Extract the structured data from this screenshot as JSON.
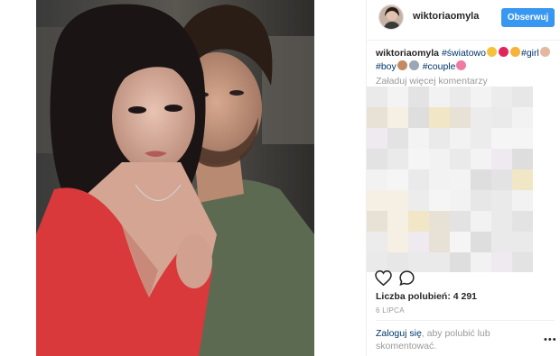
{
  "header": {
    "username": "wiktoriaomyla",
    "follow_label": "Obserwuj"
  },
  "caption": {
    "username": "wiktoriaomyla",
    "tag1": "#światowo",
    "tag2": "#girl",
    "tag3": "#boy",
    "tag4": "#couple"
  },
  "comments": {
    "load_more": "Załaduj więcej komentarzy"
  },
  "actions": {
    "like_icon": "heart-icon",
    "comment_icon": "comment-icon",
    "likes_text": "Liczba polubień: 4 291",
    "date": "6 LIPCA"
  },
  "login": {
    "link": "Zaloguj się",
    "text": ", aby polubić lub skomentować.",
    "more_icon": "more-options-icon"
  },
  "colors": {
    "accent": "#3897f0",
    "link": "#003569",
    "muted": "#999999"
  }
}
